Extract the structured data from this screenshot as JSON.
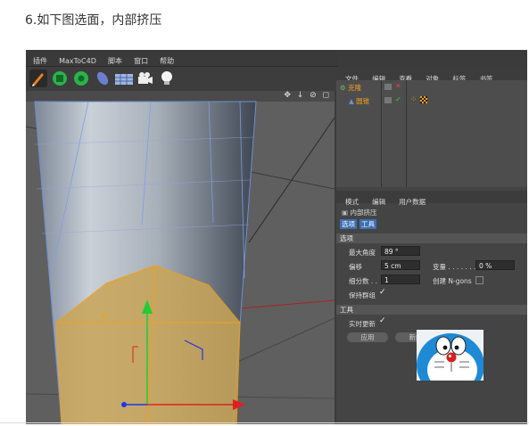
{
  "caption": "6.如下图选面，内部挤压",
  "menu": [
    "插件",
    "MaxToC4D",
    "脚本",
    "窗口",
    "帮助"
  ],
  "toolbar_icons": [
    "pen-icon",
    "cube-icon",
    "gear-icon",
    "shape-icon",
    "floor-icon",
    "camera-icon",
    "light-icon"
  ],
  "viewport_icons": "✥ ↓ ⊘ ◻",
  "object_manager": {
    "menu": [
      "文件",
      "编辑",
      "查看",
      "对象",
      "标签",
      "书签"
    ],
    "items": [
      {
        "name": "克隆",
        "indent": 0
      },
      {
        "name": "圆锥",
        "indent": 1
      }
    ]
  },
  "attributes": {
    "menu": [
      "模式",
      "编辑",
      "用户数据"
    ],
    "tool_name": "内部挤压",
    "tabs": [
      "选项",
      "工具"
    ],
    "options_section": "选项",
    "max_angle_label": "最大角度",
    "max_angle_value": "89 °",
    "offset_label": "偏移",
    "offset_value": "5 cm",
    "variance_label": "变量 . . . . . . .",
    "variance_value": "0 %",
    "subdivision_label": "细分数 . .",
    "subdivision_value": "1",
    "ngons_label": "创建 N-gons",
    "keep_groups_label": "保持群组",
    "tool_section": "工具",
    "realtime_label": "实时更新",
    "apply_button": "应用",
    "new_button": "新的"
  },
  "colors": {
    "accent_orange": "#f0a020",
    "selection_fill": "#c9a557",
    "axis_green": "#22cc33",
    "axis_red": "#e02020",
    "axis_blue": "#2233ee"
  }
}
